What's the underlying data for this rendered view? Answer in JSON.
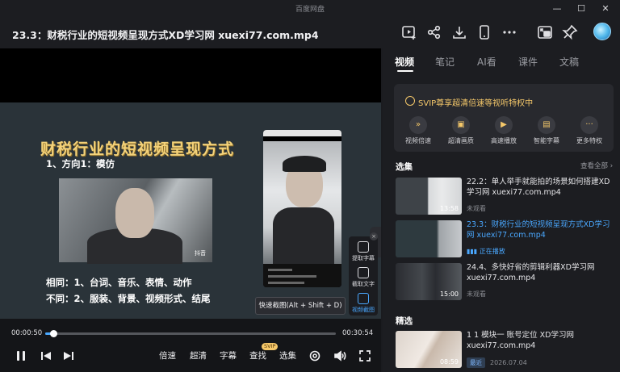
{
  "window": {
    "app_title": "百度网盘",
    "controls": [
      "minimize",
      "maximize",
      "close"
    ]
  },
  "header": {
    "file_title": "23.3：财税行业的短视频呈现方式XD学习网 xuexi77.com.mp4",
    "icons": [
      "add-to-playlist-icon",
      "share-icon",
      "download-icon",
      "phone-icon",
      "more-icon",
      "picture-in-picture-icon",
      "pin-icon",
      "avatar"
    ]
  },
  "slide": {
    "title": "财税行业的短视频呈现方式",
    "subtitle": "1、方向1：模仿",
    "line_same": "相同：1、台词、音乐、表情、动作",
    "line_diff": "不同：2、服装、背景、视频形式、结尾",
    "tiktok_mark": "抖音"
  },
  "side_tools": [
    {
      "label": "提取字幕",
      "icon": "extract-subtitle-icon",
      "active": false
    },
    {
      "label": "截取文字",
      "icon": "capture-text-icon",
      "active": false
    },
    {
      "label": "视频截图",
      "icon": "screenshot-icon",
      "active": true
    }
  ],
  "tooltip": "快速截图(Alt + Shift + D)",
  "player": {
    "current_time": "00:00:50",
    "total_time": "00:30:54",
    "progress": 0.027,
    "buttons": {
      "speed": "倍速",
      "quality": "超清",
      "subtitle": "字幕",
      "search": "查找",
      "search_badge": "SVIP",
      "episodes": "选集"
    }
  },
  "panel": {
    "tabs": [
      "视频",
      "笔记",
      "AI看",
      "课件",
      "文稿"
    ],
    "active_tab": 0,
    "svip": {
      "title": "SVIP尊享超清倍速等视听特权中",
      "perks": [
        "视频倍速",
        "超清画质",
        "高速播放",
        "智能字幕",
        "更多特权"
      ]
    },
    "episodes_title": "选集",
    "see_all": "查看全部",
    "episodes": [
      {
        "title": "22.2：单人举手就能拍的场景如何搭建XD学习网 xuexi77.com.mp4",
        "duration": "13:58",
        "status": "未观看",
        "current": false
      },
      {
        "title": "23.3：财税行业的短视频呈现方式XD学习网 xuexi77.com.mp4",
        "duration": "",
        "status": "正在播放",
        "current": true
      },
      {
        "title": "24.4、多快好省的剪辑利器XD学习网 xuexi77.com.mp4",
        "duration": "15:00",
        "status": "未观看",
        "current": false
      }
    ],
    "featured_title": "精选",
    "featured": {
      "title": "1 1 模块一 账号定位 XD学习网 xuexi77.com.mp4",
      "duration": "08:59",
      "tag": "最近",
      "date": "2026.07.04"
    }
  },
  "colors": {
    "accent": "#4aa8ff",
    "svip_gold": "#f5c86a",
    "slide_title": "#f3d27a"
  }
}
